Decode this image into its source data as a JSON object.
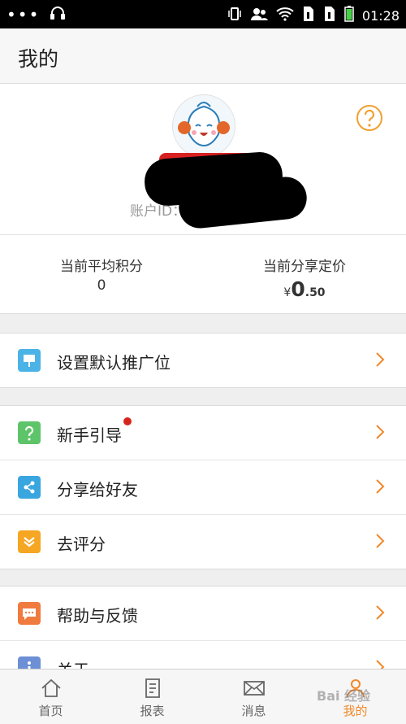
{
  "status_bar": {
    "time": "01:28"
  },
  "header": {
    "title": "我的"
  },
  "profile": {
    "account_id_label": "账户ID："
  },
  "stats": {
    "avg_points_label": "当前平均积分",
    "avg_points_value": "0",
    "share_price_label": "当前分享定价",
    "share_price_currency": "¥",
    "share_price_integer": "0",
    "share_price_decimal": ".50"
  },
  "menu": {
    "groups": [
      {
        "items": [
          {
            "label": "设置默认推广位",
            "icon": "billboard-icon",
            "color": "#4bb3e6"
          }
        ]
      },
      {
        "items": [
          {
            "label": "新手引导",
            "icon": "question-icon",
            "color": "#5ec46a",
            "badge": true
          },
          {
            "label": "分享给好友",
            "icon": "share-icon",
            "color": "#3aa6e0"
          },
          {
            "label": "去评分",
            "icon": "rate-icon",
            "color": "#f5a623"
          }
        ]
      },
      {
        "items": [
          {
            "label": "帮助与反馈",
            "icon": "chat-icon",
            "color": "#f07b3f"
          },
          {
            "label": "关于",
            "icon": "info-icon",
            "color": "#6c8fd6"
          }
        ]
      }
    ]
  },
  "tabbar": {
    "tabs": [
      {
        "label": "首页",
        "icon": "home-icon"
      },
      {
        "label": "报表",
        "icon": "report-icon"
      },
      {
        "label": "消息",
        "icon": "mail-icon"
      },
      {
        "label": "我的",
        "icon": "user-icon",
        "active": true
      }
    ]
  },
  "colors": {
    "accent": "#f0892a",
    "badge": "#d6261b"
  },
  "watermark": {
    "text": "Bai 经验"
  }
}
